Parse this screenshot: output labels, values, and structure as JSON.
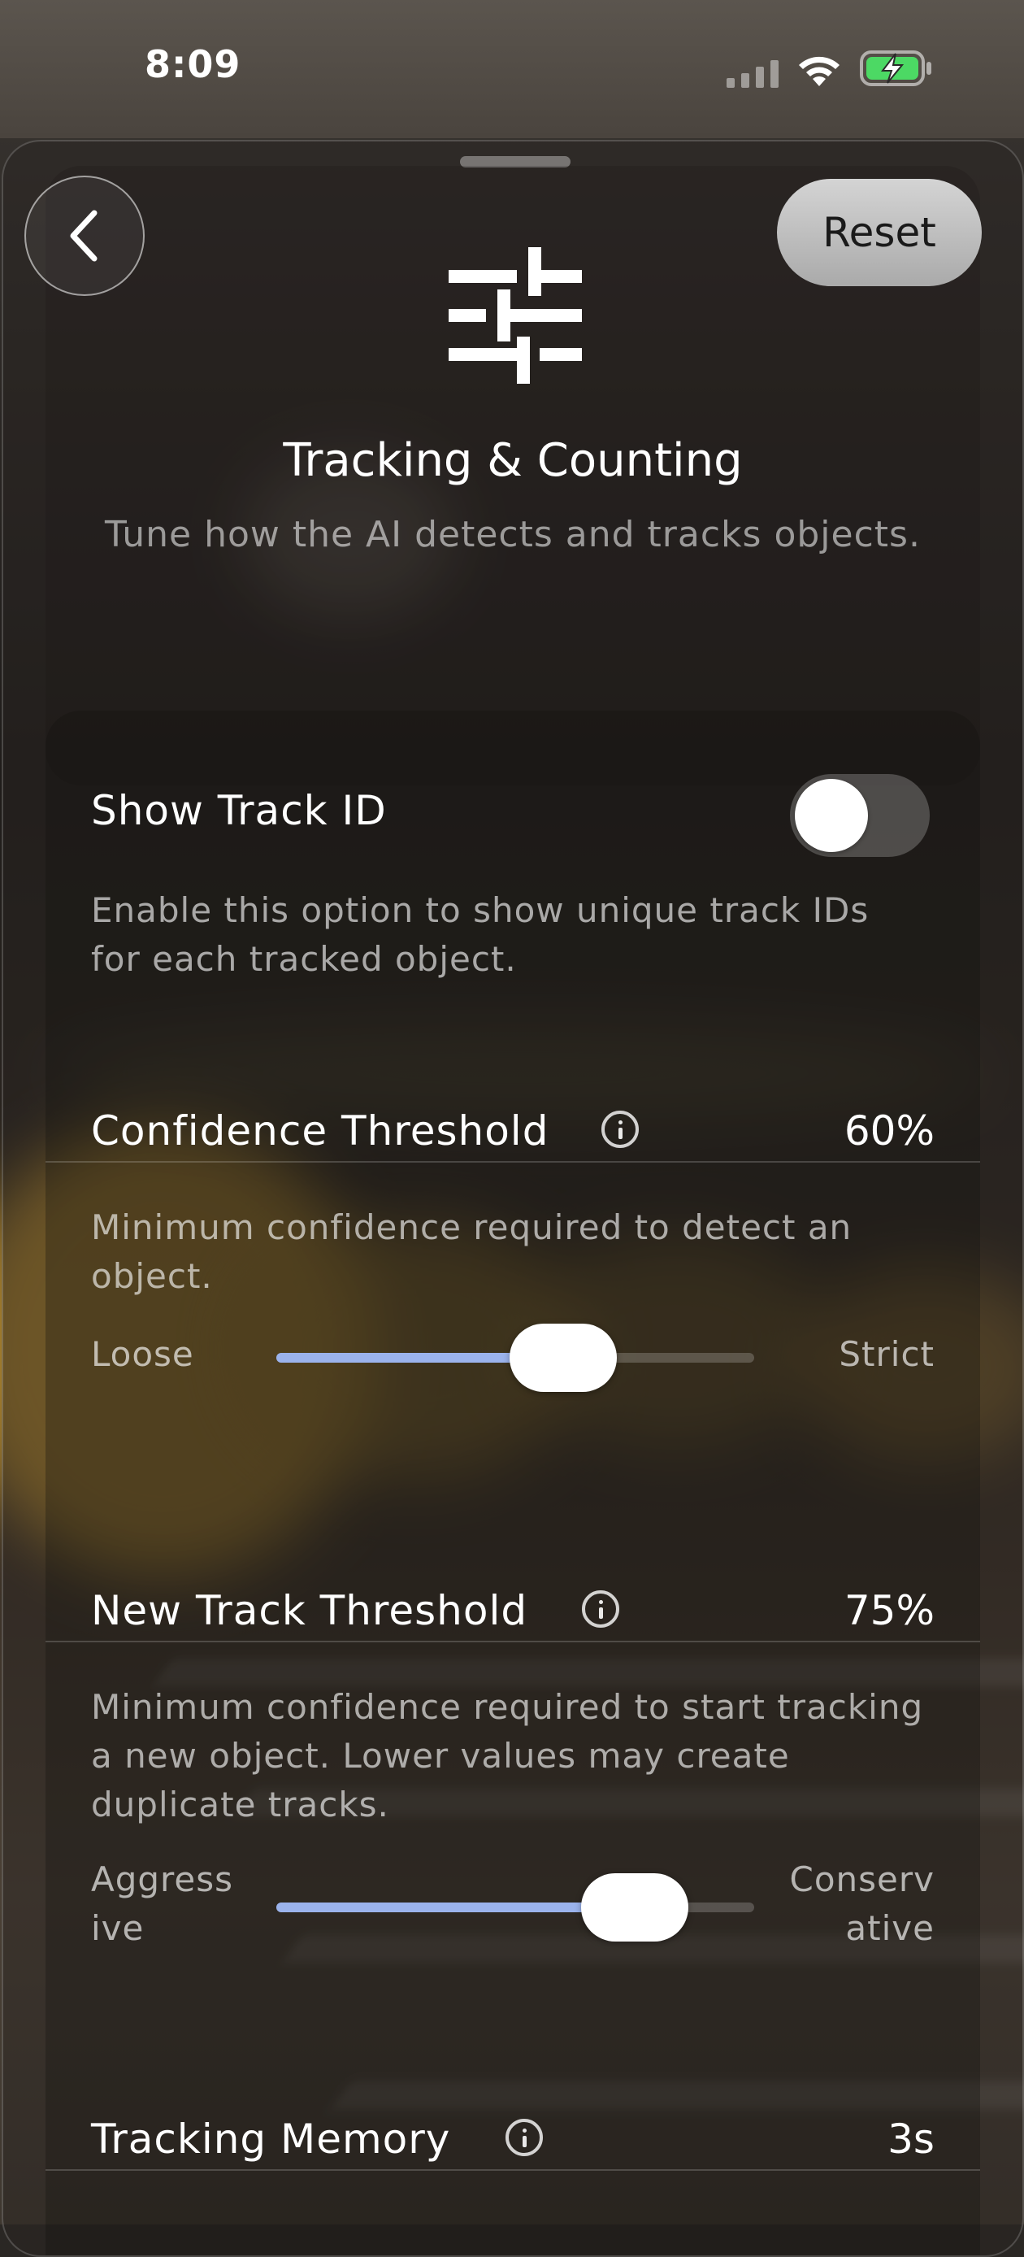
{
  "status_bar": {
    "time": "8:09",
    "icons": [
      "signal-icon",
      "wifi-icon",
      "battery-charging-icon"
    ],
    "battery_color": "#4cd964"
  },
  "header": {
    "back_icon": "chevron-left-icon",
    "reset_label": "Reset",
    "header_icon": "sliders-icon",
    "title": "Tracking & Counting",
    "subtitle": "Tune how the AI detects and tracks objects."
  },
  "settings": {
    "show_track_id": {
      "title": "Show Track ID",
      "description": "Enable this option to show unique track IDs for each tracked object.",
      "enabled": false
    },
    "confidence_threshold": {
      "title": "Confidence Threshold",
      "value_label": "60%",
      "description": "Minimum confidence required to detect an object.",
      "min_label": "Loose",
      "max_label": "Strict",
      "fraction": 0.6
    },
    "new_track_threshold": {
      "title": "New Track Threshold",
      "value_label": "75%",
      "description": "Minimum confidence required to start tracking a new object. Lower values may create duplicate tracks.",
      "min_label_1": "Aggress",
      "min_label_2": "ive",
      "max_label_1": "Conserv",
      "max_label_2": "ative",
      "fraction": 0.75
    },
    "tracking_memory": {
      "title": "Tracking Memory",
      "value_label": "3s"
    }
  },
  "colors": {
    "slider_fill": "#9bb3ec",
    "reset_button": "#c9c9c9"
  }
}
